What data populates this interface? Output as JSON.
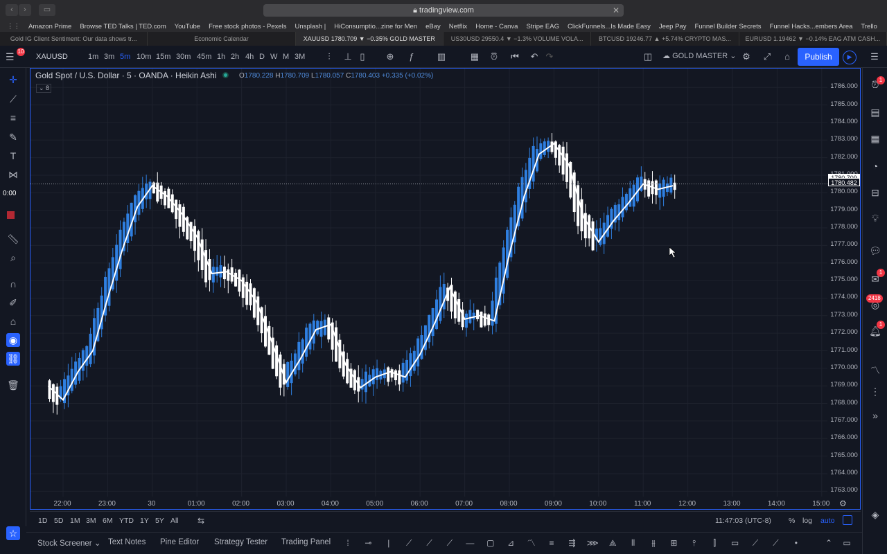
{
  "browser": {
    "url": "tradingview.com",
    "bookmarks": [
      "Amazon Prime",
      "Browse TED Talks | TED.com",
      "YouTube",
      "Free stock photos - Pexels",
      "Unsplash |",
      "HiConsumptio...zine for Men",
      "eBay",
      "Netflix",
      "Home - Canva",
      "Stripe EAG",
      "ClickFunnels...Is Made Easy",
      "Jeep Pay",
      "Funnel Builder Secrets",
      "Funnel Hacks...embers Area",
      "Trello"
    ],
    "tabs": [
      "Gold IG Client Sentiment: Our data shows tr...",
      "Economic Calendar",
      "XAUUSD 1780.709 ▼ −0.35% GOLD MASTER",
      "US30USD 29550.4 ▼ −1.3% VOLUME VOLA...",
      "BTCUSD 19246.77 ▲ +5.74% CRYPTO MAS...",
      "EURUSD 1.19462 ▼ −0.14% EAG ATM CASH..."
    ]
  },
  "toolbar": {
    "symbol": "XAUUSD",
    "timeframes": [
      "1m",
      "3m",
      "5m",
      "10m",
      "15m",
      "30m",
      "45m",
      "1h",
      "2h",
      "4h",
      "D",
      "W",
      "M",
      "3M"
    ],
    "active_timeframe": "5m",
    "layout_name": "GOLD MASTER",
    "publish_label": "Publish"
  },
  "left_toolbar": {
    "timer": "0:00"
  },
  "right_toolbar": {
    "badges": [
      "1",
      "1",
      "2418",
      "1"
    ]
  },
  "chart": {
    "title": "Gold Spot / U.S. Dollar · 5 · OANDA · Heikin Ashi",
    "ohlc": {
      "o_label": "O",
      "o": "1780.228",
      "h_label": "H",
      "h": "1780.709",
      "l_label": "L",
      "l": "1780.057",
      "c_label": "C",
      "c": "1780.403",
      "change": "+0.335 (+0.02%)"
    },
    "ma_length": "8",
    "last_price": "1780.709",
    "ma_price": "1780.482",
    "time_label": "11:47:03 (UTC-8)",
    "scale_options": [
      "%",
      "log",
      "auto"
    ],
    "colors": {
      "up": "#2f7fe0",
      "down": "#ffffff",
      "ma": "#ffffff",
      "accent": "#2962ff"
    }
  },
  "ranges": [
    "1D",
    "5D",
    "1M",
    "3M",
    "6M",
    "YTD",
    "1Y",
    "5Y",
    "All"
  ],
  "bottom_tabs": [
    "Stock Screener",
    "Text Notes",
    "Pine Editor",
    "Strategy Tester",
    "Trading Panel"
  ],
  "chart_data": {
    "type": "candlestick",
    "title": "Gold Spot / U.S. Dollar · 5 · OANDA · Heikin Ashi",
    "x_ticks": [
      "22:00",
      "23:00",
      "30",
      "01:00",
      "02:00",
      "03:00",
      "04:00",
      "05:00",
      "06:00",
      "07:00",
      "08:00",
      "09:00",
      "10:00",
      "11:00",
      "12:00",
      "13:00",
      "14:00",
      "15:00"
    ],
    "y_ticks": [
      "1786.000",
      "1785.000",
      "1784.000",
      "1783.000",
      "1782.000",
      "1781.000",
      "1780.000",
      "1779.000",
      "1778.000",
      "1777.000",
      "1776.000",
      "1775.000",
      "1774.000",
      "1773.000",
      "1772.000",
      "1771.000",
      "1770.000",
      "1769.000",
      "1768.000",
      "1767.000",
      "1766.000",
      "1765.000",
      "1764.000",
      "1763.000"
    ],
    "ylim": [
      1762.5,
      1786.6
    ],
    "series": [
      {
        "name": "MA 8",
        "type": "line",
        "x": [
          "21:40",
          "22:00",
          "22:20",
          "22:40",
          "23:00",
          "23:20",
          "23:40",
          "00:00",
          "00:20",
          "00:40",
          "01:00",
          "01:20",
          "01:40",
          "02:00",
          "02:20",
          "02:40",
          "03:00",
          "03:20",
          "03:40",
          "04:00",
          "04:20",
          "04:40",
          "05:00",
          "05:20",
          "05:40",
          "06:00",
          "06:20",
          "06:40",
          "07:00",
          "07:20",
          "07:40",
          "08:00",
          "08:20",
          "08:40",
          "09:00",
          "09:20",
          "09:40",
          "10:00",
          "10:20",
          "10:40",
          "11:00",
          "11:20",
          "11:40"
        ],
        "values": [
          1769.0,
          1768.2,
          1769.8,
          1771.0,
          1774.0,
          1776.8,
          1779.2,
          1780.4,
          1779.8,
          1778.8,
          1777.5,
          1775.4,
          1775.5,
          1775.0,
          1773.8,
          1771.6,
          1769.2,
          1770.6,
          1772.2,
          1772.5,
          1770.2,
          1768.9,
          1769.5,
          1769.8,
          1769.5,
          1770.8,
          1772.6,
          1774.6,
          1772.8,
          1773.0,
          1772.7,
          1776.5,
          1779.8,
          1782.2,
          1782.8,
          1781.6,
          1778.6,
          1777.2,
          1778.4,
          1779.4,
          1780.5,
          1780.2,
          1780.4
        ]
      },
      {
        "name": "Heikin Ashi candles",
        "type": "candlestick",
        "note": "up candles blue, down candles white",
        "values": "see script (approximated from MA path)"
      }
    ]
  }
}
